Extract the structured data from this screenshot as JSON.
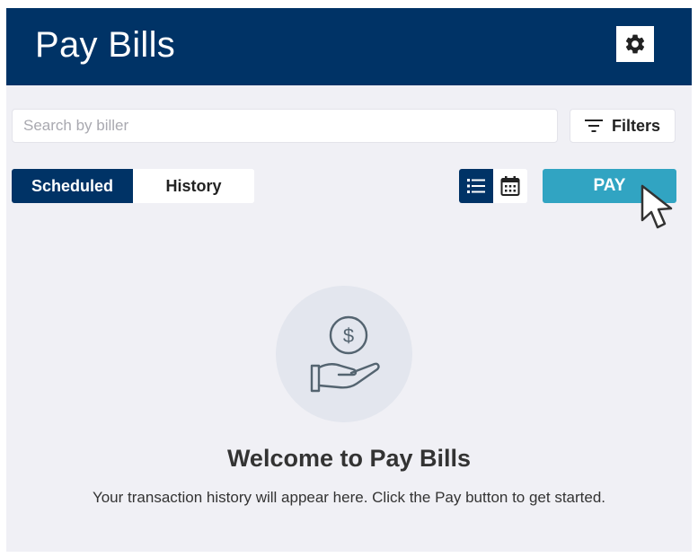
{
  "header": {
    "title": "Pay Bills",
    "settings_icon": "gear-icon",
    "background": "#003366"
  },
  "search": {
    "placeholder": "Search by biller",
    "value": ""
  },
  "filters": {
    "label": "Filters",
    "icon": "filter-lines-icon"
  },
  "tabs": [
    {
      "label": "Scheduled",
      "active": true
    },
    {
      "label": "History",
      "active": false
    }
  ],
  "view_toggle": [
    {
      "icon": "list-icon",
      "active": true
    },
    {
      "icon": "calendar-icon",
      "active": false
    }
  ],
  "pay_button": {
    "label": "PAY",
    "color": "#31a4c2"
  },
  "empty_state": {
    "icon": "hand-dollar-icon",
    "title": "Welcome to Pay Bills",
    "message": "Your transaction history will appear here. Click the Pay button to get started."
  }
}
